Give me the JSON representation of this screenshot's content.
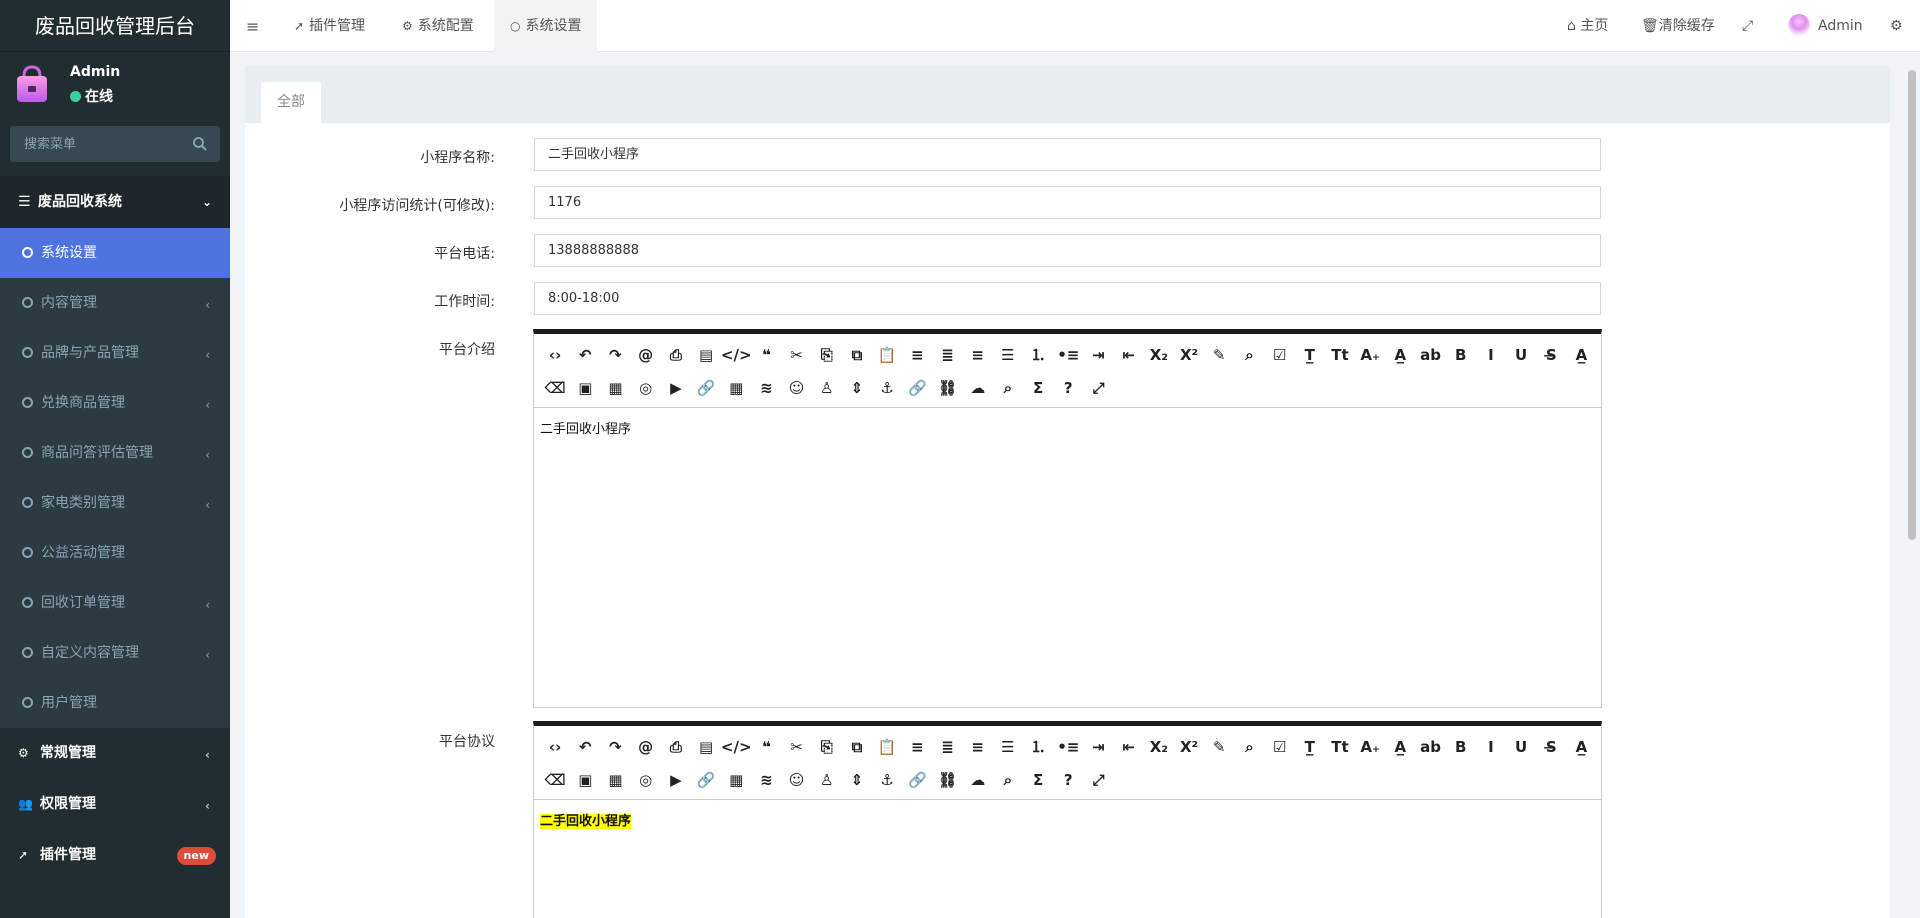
{
  "app": {
    "title": "废品回收管理后台"
  },
  "user": {
    "name": "Admin",
    "status": "在线"
  },
  "search": {
    "placeholder": "搜索菜单"
  },
  "menu": {
    "group_title": "废品回收系统",
    "items": [
      {
        "label": "系统设置",
        "has_arrow": false
      },
      {
        "label": "内容管理",
        "has_arrow": true
      },
      {
        "label": "品牌与产品管理",
        "has_arrow": true
      },
      {
        "label": "兑换商品管理",
        "has_arrow": true
      },
      {
        "label": "商品问答评估管理",
        "has_arrow": true
      },
      {
        "label": "家电类别管理",
        "has_arrow": true
      },
      {
        "label": "公益活动管理",
        "has_arrow": false
      },
      {
        "label": "回收订单管理",
        "has_arrow": true
      },
      {
        "label": "自定义内容管理",
        "has_arrow": true
      },
      {
        "label": "用户管理",
        "has_arrow": false
      }
    ],
    "general": "常规管理",
    "permissions": "权限管理",
    "plugins": "插件管理",
    "plugins_badge": "new"
  },
  "navbar": {
    "tabs": [
      {
        "label": "插件管理",
        "icon": "rocket-icon"
      },
      {
        "label": "系统配置",
        "icon": "gear-icon"
      },
      {
        "label": "系统设置",
        "icon": "circle-icon"
      }
    ],
    "home": "主页",
    "clear_cache": "清除缓存",
    "user": "Admin"
  },
  "content": {
    "tab": "全部",
    "fields": {
      "name_label": "小程序名称:",
      "name_value": "二手回收小程序",
      "visits_label": "小程序访问统计(可修改):",
      "visits_value": "1176",
      "phone_label": "平台电话:",
      "phone_value": "13888888888",
      "hours_label": "工作时间:",
      "hours_value": "8:00-18:00",
      "intro_label": "平台介绍",
      "intro_value": "二手回收小程序",
      "agreement_label": "平台协议",
      "agreement_value": "二手回收小程序"
    }
  },
  "colors": {
    "sidebar_bg": "#222d32",
    "active_item": "#4e73df",
    "status_online": "#3bd19f",
    "badge_new": "#dd4b39",
    "highlight": "#ffff00"
  }
}
